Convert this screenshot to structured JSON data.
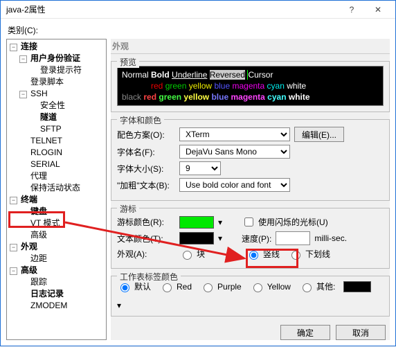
{
  "title": "java-2属性",
  "category_label": "类别(C):",
  "tree": {
    "n0": "连接",
    "n0_0": "用户身份验证",
    "n0_0_0": "登录提示符",
    "n0_1": "登录脚本",
    "n0_2": "SSH",
    "n0_2_0": "安全性",
    "n0_2_1": "隧道",
    "n0_2_2": "SFTP",
    "n0_3": "TELNET",
    "n0_4": "RLOGIN",
    "n0_5": "SERIAL",
    "n0_6": "代理",
    "n0_7": "保持活动状态",
    "n1": "终端",
    "n1_0": "键盘",
    "n1_1": "VT 模式",
    "n1_2": "高级",
    "n2": "外观",
    "n2_0": "边距",
    "n3": "高级",
    "n3_0": "跟踪",
    "n3_1": "日志记录",
    "n3_2": "ZMODEM"
  },
  "panel_title": "外观",
  "preview_legend": "预览",
  "preview": {
    "l1": {
      "normal": "Normal",
      "bold": "Bold",
      "underline": "Underline",
      "reversed": "Reversed",
      "cursor": "Cursor"
    },
    "words": {
      "black": "black",
      "red": "red",
      "green": "green",
      "yellow": "yellow",
      "blue": "blue",
      "magenta": "magenta",
      "cyan": "cyan",
      "white": "white"
    }
  },
  "font_group": {
    "legend": "字体和颜色",
    "scheme_label": "配色方案(O):",
    "scheme_value": "XTerm",
    "edit_btn": "编辑(E)...",
    "fontname_label": "字体名(F):",
    "fontname_value": "DejaVu Sans Mono",
    "fontsize_label": "字体大小(S):",
    "fontsize_value": "9",
    "boldtext_label": "\"加粗\"文本(B):",
    "boldtext_value": "Use bold color and font"
  },
  "cursor_group": {
    "legend": "游标",
    "cursor_color_label": "游标颜色(R):",
    "cursor_color": "#00e800",
    "blink_label": "使用闪烁的光标(U)",
    "text_color_label": "文本颜色(T):",
    "text_color": "#000000",
    "speed_label": "速度(P):",
    "speed_unit": "milli-sec.",
    "shape_label": "外观(A):",
    "shape_block": "块",
    "shape_vline": "竖线",
    "shape_uline": "下划线",
    "shape_selected": "vline"
  },
  "ws_group": {
    "legend": "工作表标签颜色",
    "default": "默认",
    "red": "Red",
    "purple": "Purple",
    "yellow": "Yellow",
    "other": "其他:"
  },
  "buttons": {
    "ok": "确定",
    "cancel": "取消"
  }
}
